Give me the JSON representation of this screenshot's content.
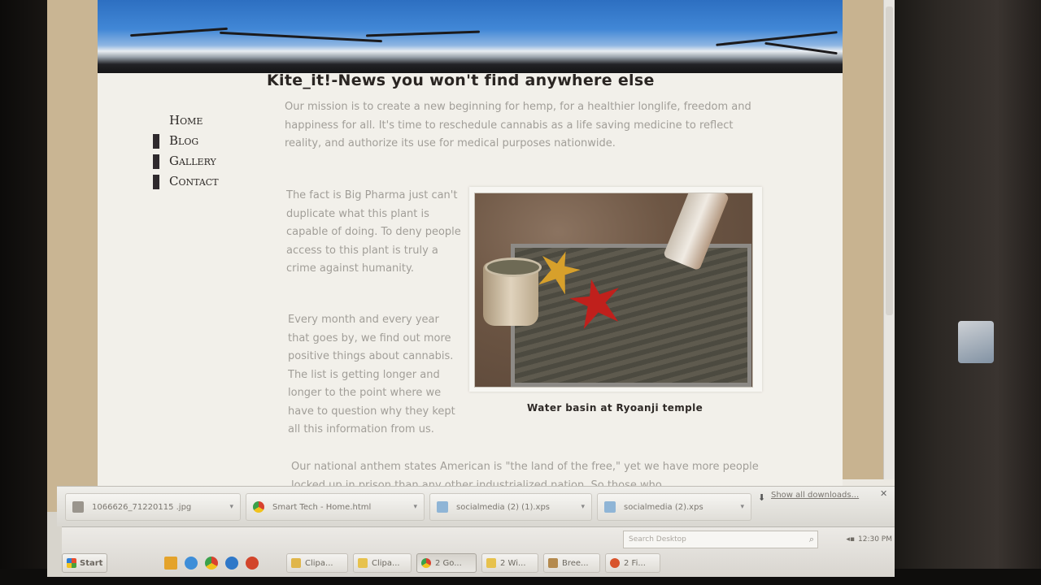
{
  "site": {
    "title": "Kite_it!-News you won't find anywhere else",
    "nav": [
      "Home",
      "Blog",
      "Gallery",
      "Contact"
    ]
  },
  "article": {
    "mission": "Our mission is to create a new beginning for hemp, for a healthier longlife, freedom and happiness for all. It's time to reschedule cannabis as a life saving medicine to reflect reality, and authorize its use for medical purposes nationwide.",
    "fact": "The fact is Big Pharma just can't duplicate what this plant is capable of doing. To deny people access to this plant is truly a crime against humanity.",
    "every_month": "Every month and every year that goes by, we find out more positive things about cannabis. The list is getting longer and longer to the point where we have to question why they kept all this information from us.",
    "anthem": "Our national anthem states American is \"the land of the free,\" yet we have more people locked up in prison than any other industrialized nation. So those who",
    "caption": "Water basin at Ryoanji temple"
  },
  "downloads": {
    "items": [
      "1066626_71220115 .jpg",
      "Smart Tech - Home.html",
      "socialmedia (2) (1).xps",
      "socialmedia (2).xps"
    ],
    "show_all": "Show all downloads..."
  },
  "taskbar": {
    "start": "Start",
    "buttons": [
      "Clipa...",
      "Clipa...",
      "2 Go...",
      "2 Wi...",
      "Bree...",
      "2 Fi..."
    ],
    "search_placeholder": "Search Desktop",
    "clock": "12:30 PM"
  },
  "colors": {
    "banner_sky": "#3a80d0",
    "page_bg": "#f2f0ea",
    "side_tan": "#c9b593",
    "body_text": "#a19e98",
    "title_text": "#2a2522"
  }
}
